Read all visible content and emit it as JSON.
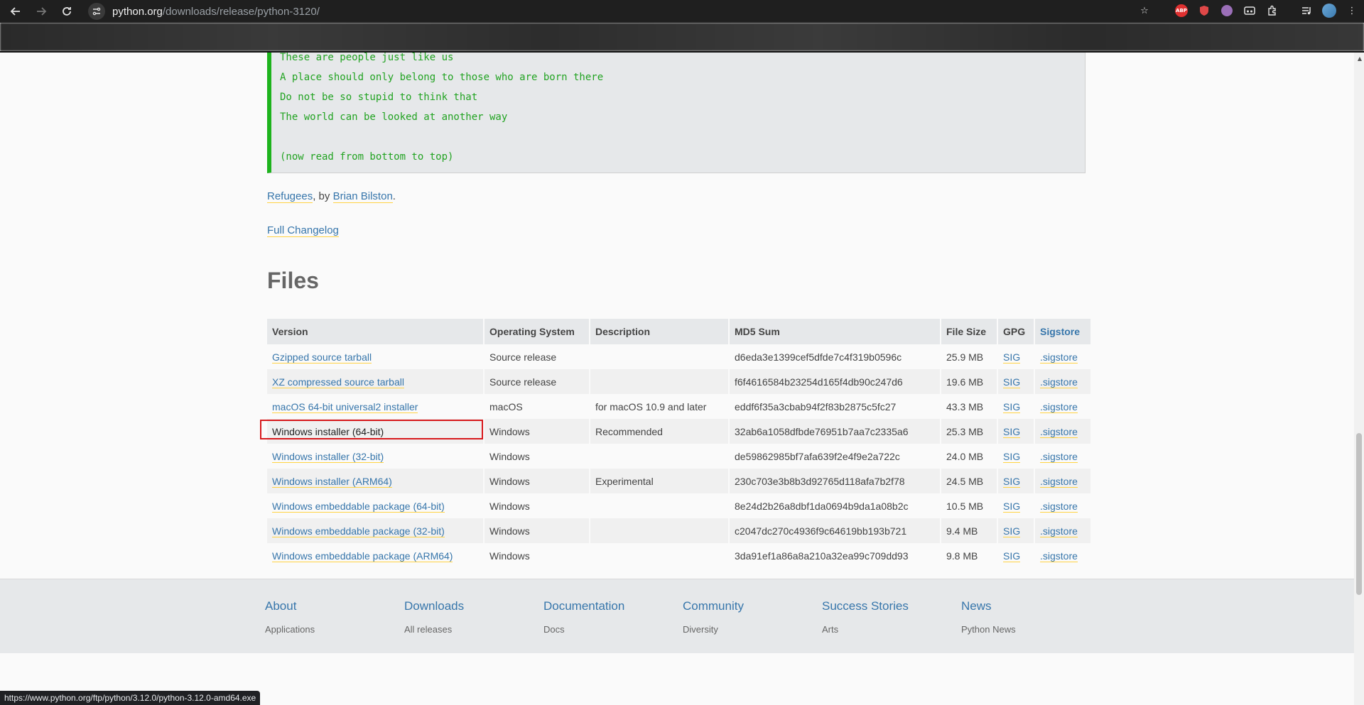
{
  "browser": {
    "url_host": "python.org",
    "url_path": "/downloads/release/python-3120/",
    "status_url": "https://www.python.org/ftp/python/3.12.0/python-3.12.0-amd64.exe",
    "extensions": [
      "abp-icon",
      "shield-icon",
      "purple-extension-icon",
      "mask-icon",
      "puzzle-icon",
      "media-icon",
      "profile-avatar"
    ]
  },
  "poem": {
    "lines": [
      "These are people just like us",
      "A place should only belong to those who are born there",
      "Do not be so stupid to think that",
      "The world can be looked at another way",
      "",
      "(now read from bottom to top)"
    ]
  },
  "credit": {
    "title_link": "Refugees",
    "by": ", by ",
    "author_link": "Brian Bilston",
    "period": "."
  },
  "changelog_link": "Full Changelog",
  "files": {
    "heading": "Files",
    "headers": [
      "Version",
      "Operating System",
      "Description",
      "MD5 Sum",
      "File Size",
      "GPG",
      "Sigstore"
    ],
    "rows": [
      {
        "version": "Gzipped source tarball",
        "os": "Source release",
        "description": "",
        "md5": "d6eda3e1399cef5dfde7c4f319b0596c",
        "size": "25.9 MB",
        "gpg": "SIG",
        "sigstore": ".sigstore"
      },
      {
        "version": "XZ compressed source tarball",
        "os": "Source release",
        "description": "",
        "md5": "f6f4616584b23254d165f4db90c247d6",
        "size": "19.6 MB",
        "gpg": "SIG",
        "sigstore": ".sigstore"
      },
      {
        "version": "macOS 64-bit universal2 installer",
        "os": "macOS",
        "description": "for macOS 10.9 and later",
        "md5": "eddf6f35a3cbab94f2f83b2875c5fc27",
        "size": "43.3 MB",
        "gpg": "SIG",
        "sigstore": ".sigstore"
      },
      {
        "version": "Windows installer (64-bit)",
        "os": "Windows",
        "description": "Recommended",
        "md5": "32ab6a1058dfbde76951b7aa7c2335a6",
        "size": "25.3 MB",
        "gpg": "SIG",
        "sigstore": ".sigstore"
      },
      {
        "version": "Windows installer (32-bit)",
        "os": "Windows",
        "description": "",
        "md5": "de59862985bf7afa639f2e4f9e2a722c",
        "size": "24.0 MB",
        "gpg": "SIG",
        "sigstore": ".sigstore"
      },
      {
        "version": "Windows installer (ARM64)",
        "os": "Windows",
        "description": "Experimental",
        "md5": "230c703e3b8b3d92765d118afa7b2f78",
        "size": "24.5 MB",
        "gpg": "SIG",
        "sigstore": ".sigstore"
      },
      {
        "version": "Windows embeddable package (64-bit)",
        "os": "Windows",
        "description": "",
        "md5": "8e24d2b26a8dbf1da0694b9da1a08b2c",
        "size": "10.5 MB",
        "gpg": "SIG",
        "sigstore": ".sigstore"
      },
      {
        "version": "Windows embeddable package (32-bit)",
        "os": "Windows",
        "description": "",
        "md5": "c2047dc270c4936f9c64619bb193b721",
        "size": "9.4 MB",
        "gpg": "SIG",
        "sigstore": ".sigstore"
      },
      {
        "version": "Windows embeddable package (ARM64)",
        "os": "Windows",
        "description": "",
        "md5": "3da91ef1a86a8a210a32ea99c709dd93",
        "size": "9.8 MB",
        "gpg": "SIG",
        "sigstore": ".sigstore"
      }
    ]
  },
  "footer": {
    "columns": [
      {
        "heading": "About",
        "first_item": "Applications"
      },
      {
        "heading": "Downloads",
        "first_item": "All releases"
      },
      {
        "heading": "Documentation",
        "first_item": "Docs"
      },
      {
        "heading": "Community",
        "first_item": "Diversity"
      },
      {
        "heading": "Success Stories",
        "first_item": "Arts"
      },
      {
        "heading": "News",
        "first_item": "Python News"
      }
    ]
  },
  "colors": {
    "link": "#3776ab",
    "link_underline": "#ffd343",
    "poem_text": "#22a322",
    "poem_bar": "#1db31d",
    "highlight": "#d7191c"
  }
}
